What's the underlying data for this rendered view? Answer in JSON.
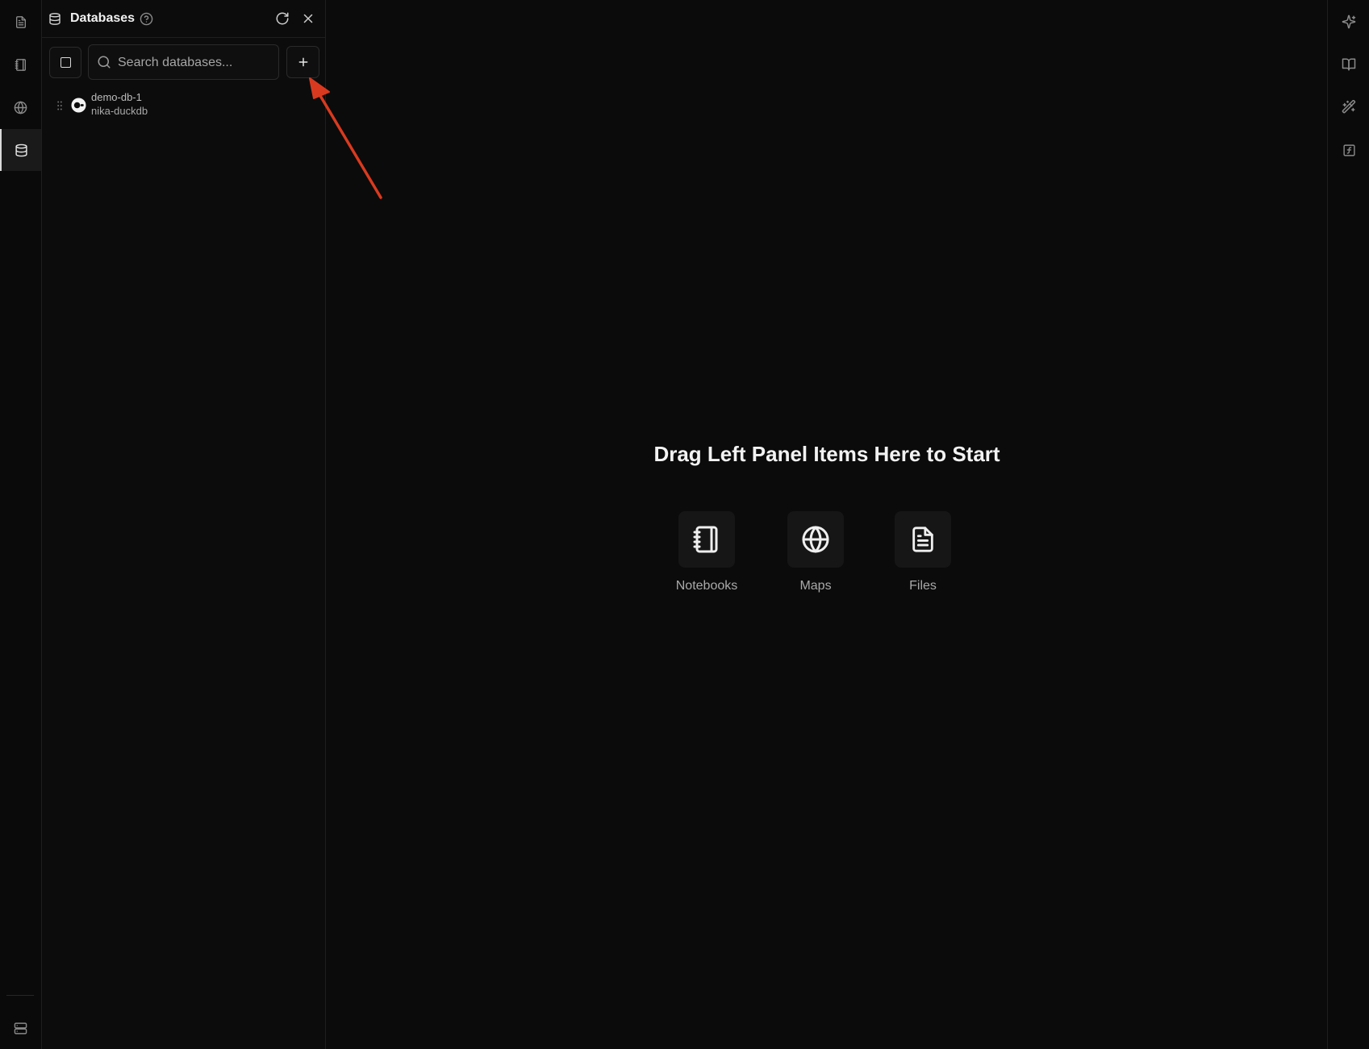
{
  "activity_bar": {
    "items": [
      {
        "name": "files",
        "icon": "file-text-icon"
      },
      {
        "name": "notebooks",
        "icon": "notebook-icon"
      },
      {
        "name": "maps",
        "icon": "globe-icon"
      },
      {
        "name": "databases",
        "icon": "database-icon",
        "active": true
      }
    ],
    "bottom_icon": "server-icon"
  },
  "panel": {
    "title": "Databases",
    "search_placeholder": "Search databases...",
    "items": [
      {
        "name": "demo-db-1",
        "type": "nika-duckdb",
        "icon": "duckdb-icon"
      }
    ]
  },
  "workspace": {
    "empty_title": "Drag Left Panel Items Here to Start",
    "tiles": [
      {
        "label": "Notebooks",
        "icon": "notebook-icon"
      },
      {
        "label": "Maps",
        "icon": "globe-icon"
      },
      {
        "label": "Files",
        "icon": "file-text-icon"
      }
    ]
  },
  "right_bar": {
    "items": [
      "sparkles-icon",
      "book-open-icon",
      "magic-wand-icon",
      "function-icon"
    ]
  },
  "annotation": {
    "color": "#d93a1f",
    "target": "add-database-button"
  }
}
